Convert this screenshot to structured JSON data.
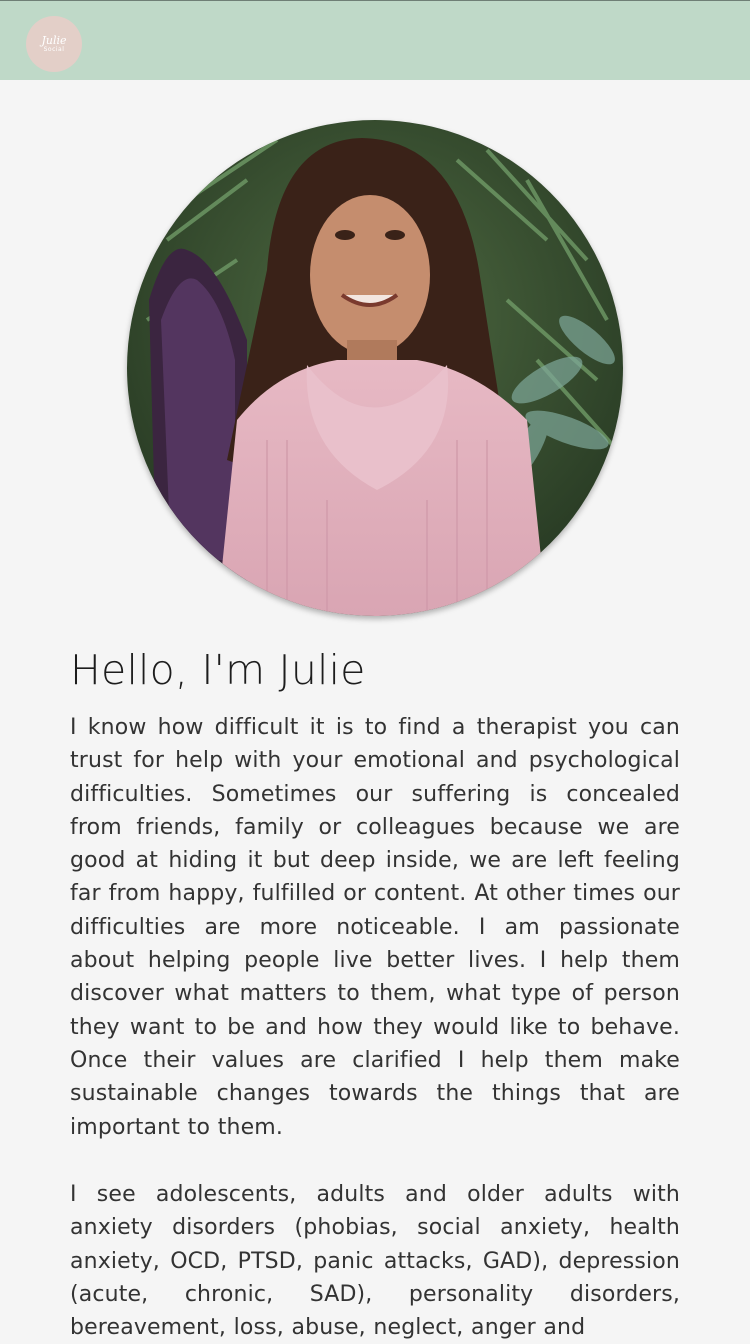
{
  "header": {
    "logo_line1": "Julie",
    "logo_line2": "Social",
    "colors": {
      "bar": "#bfd9c8",
      "logo_bg": "#e3cfc8"
    }
  },
  "profile": {
    "photo_icon": "portrait-photo"
  },
  "content": {
    "title": "Hello, I'm Julie",
    "paragraph1": "I know how difficult it is to find a therapist you can trust for help with your emotional and psychological difficulties. Sometimes our suffering is concealed from friends, family or colleagues because we are good at hiding it but deep inside, we are left feeling far from happy, fulfilled or content. At other times our difficulties are more noticeable. I am passionate about helping people live better lives. I help them discover what matters to them, what type of person they want to be and how they would like to behave. Once their values are clarified I help them make sustainable changes towards the things that are important to them.",
    "paragraph2": "I see adolescents, adults and older adults with anxiety disorders (phobias, social anxiety, health anxiety, OCD, PTSD, panic attacks, GAD), depression (acute, chronic, SAD), personality disorders, bereavement, loss, abuse, neglect, anger and"
  }
}
